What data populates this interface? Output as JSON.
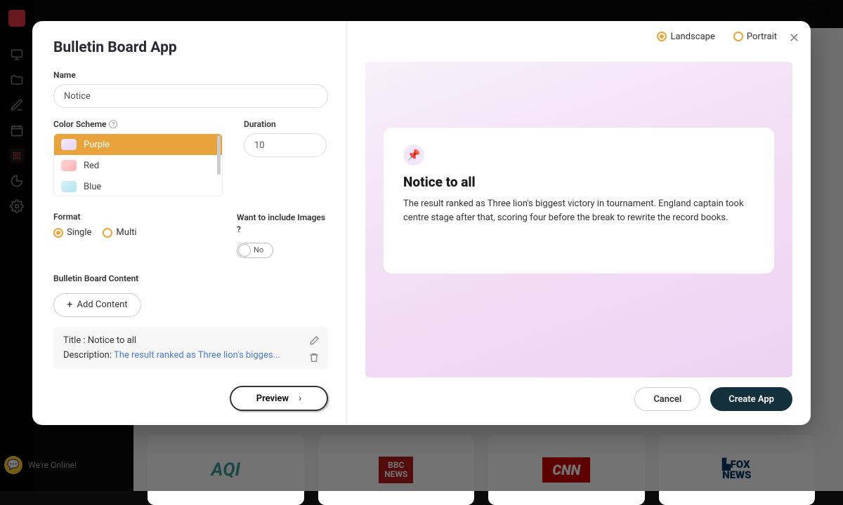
{
  "modal": {
    "title": "Bulletin Board App",
    "name_label": "Name",
    "name_value": "Notice",
    "color_label": "Color Scheme",
    "colors": [
      {
        "label": "Purple",
        "swatch": "purple",
        "selected": true
      },
      {
        "label": "Red",
        "swatch": "red",
        "selected": false
      },
      {
        "label": "Blue",
        "swatch": "blue",
        "selected": false
      }
    ],
    "duration_label": "Duration",
    "duration_value": "10",
    "format_label": "Format",
    "formats": [
      {
        "label": "Single",
        "checked": true
      },
      {
        "label": "Multi",
        "checked": false
      }
    ],
    "images_question": "Want to include Images ?",
    "images_toggle": "No",
    "content_label": "Bulletin Board Content",
    "add_content": "Add Content",
    "content_item": {
      "title_prefix": "Title : ",
      "title": "Notice to all",
      "desc_prefix": "Description: ",
      "desc": "The result ranked as Three lion's bigges..."
    },
    "preview_btn": "Preview"
  },
  "orientation": [
    {
      "label": "Landscape",
      "checked": true
    },
    {
      "label": "Portrait",
      "checked": false
    }
  ],
  "preview": {
    "title": "Notice to all",
    "body": "The result ranked as Three lion's biggest victory in tournament. England captain took centre stage after that, scoring four before the break to rewrite the record books."
  },
  "footer": {
    "cancel": "Cancel",
    "create": "Create App"
  },
  "chat": {
    "text": "We're Online!"
  },
  "bg_cards": [
    "AQI",
    "BBC\nNEWS",
    "CNN",
    "FOX\nNEWS"
  ]
}
